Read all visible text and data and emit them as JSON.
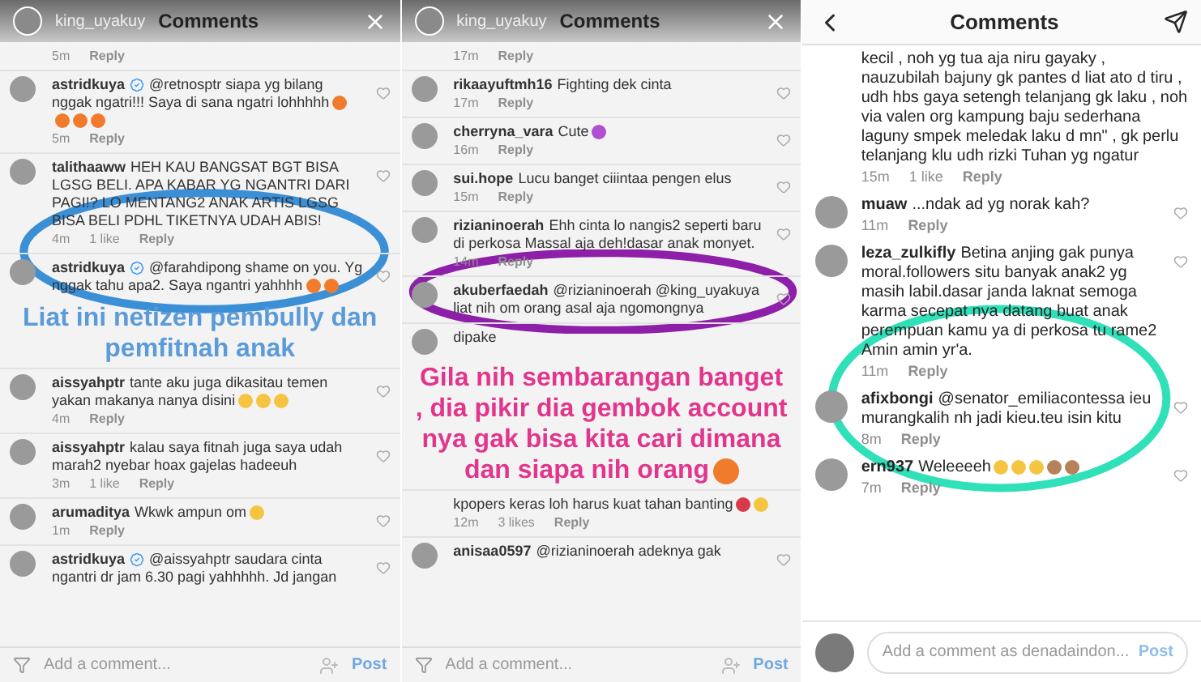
{
  "panels": [
    {
      "header": {
        "kind": "close",
        "username": "king_uyakuy",
        "title": "Comments"
      },
      "comments": [
        {
          "kind": "comment",
          "time": "5m",
          "reply": "Reply"
        },
        {
          "kind": "comment",
          "username": "astridkuya",
          "verified": true,
          "text": "@retnosptr  siapa yg bilang nggak ngatri!!! Saya di sana ngatri lohhhhh",
          "emojis": [
            {
              "kind": "angry"
            },
            {
              "kind": "angry"
            },
            {
              "kind": "angry"
            },
            {
              "kind": "angry"
            }
          ],
          "time": "5m",
          "reply": "Reply"
        },
        {
          "kind": "comment",
          "username": "talithaaww",
          "text": "HEH KAU BANGSAT BGT BISA LGSG BELI. APA KABAR YG NGANTRI DARI PAGI!? LO MENTANG2 ANAK ARTIS LGSG BISA BELI PDHL TIKETNYA UDAH ABIS!",
          "time": "4m",
          "likes": "1 like",
          "reply": "Reply"
        },
        {
          "kind": "comment",
          "username": "astridkuya",
          "verified": true,
          "text": "@farahdipong shame on you. Yg nggak tahu apa2. Saya ngantri yahhhh",
          "emojis": [
            {
              "kind": "angry"
            },
            {
              "kind": "angry"
            }
          ]
        },
        {
          "kind": "caption",
          "text": "Liat ini netizen pembully dan pemfitnah anak",
          "color": "#5b9bd9"
        },
        {
          "kind": "comment",
          "username": "aissyahptr",
          "text": "tante aku juga dikasitau temen yakan makanya nanya disini",
          "emojis": [
            {
              "kind": "laugh"
            },
            {
              "kind": "laugh"
            },
            {
              "kind": "laugh"
            }
          ],
          "time": "4m",
          "reply": "Reply"
        },
        {
          "kind": "comment",
          "username": "aissyahptr",
          "text": "kalau saya fitnah juga saya udah marah2 nyebar hoax gajelas hadeeuh",
          "time": "3m",
          "likes": "1 like",
          "reply": "Reply"
        },
        {
          "kind": "comment",
          "username": "arumaditya",
          "text": "Wkwk ampun om",
          "emojis": [
            {
              "kind": "laugh"
            }
          ],
          "time": "1m",
          "reply": "Reply"
        },
        {
          "kind": "comment",
          "username": "astridkuya",
          "verified": true,
          "text": "@aissyahptr saudara cinta ngantri dr jam 6.30 pagi yahhhhh. Jd jangan"
        }
      ],
      "footer": {
        "kind": "plain",
        "placeholder": "Add a comment...",
        "post": "Post"
      },
      "circle": {
        "color": "#3b8fd6"
      }
    },
    {
      "header": {
        "kind": "close",
        "username": "king_uyakuy",
        "title": "Comments"
      },
      "comments": [
        {
          "kind": "comment",
          "time": "17m",
          "reply": "Reply"
        },
        {
          "kind": "comment",
          "username": "rikaayuftmh16",
          "text": "Fighting dek cinta",
          "time": "17m",
          "reply": "Reply"
        },
        {
          "kind": "comment",
          "username": "cherryna_vara",
          "text": "Cute",
          "emojis": [
            {
              "kind": "purple_heart"
            }
          ],
          "time": "16m",
          "reply": "Reply"
        },
        {
          "kind": "comment",
          "username": "sui.hope",
          "text": "Lucu banget ciiintaa pengen elus",
          "time": "15m",
          "reply": "Reply"
        },
        {
          "kind": "comment",
          "username": "rizianinoerah",
          "text": "Ehh cinta lo nangis2 seperti baru di perkosa Massal aja deh!dasar anak monyet.",
          "time": "14m",
          "reply": "Reply"
        },
        {
          "kind": "comment",
          "username": "akuberfaedah",
          "text": "@rizianinoerah @king_uyakuya liat nih om orang asal aja ngomongnya"
        },
        {
          "kind": "comment",
          "text": "dipake",
          "avatar": true
        },
        {
          "kind": "caption",
          "text": "Gila nih sembarangan banget , dia pikir dia gembok account nya gak bisa kita cari dimana dan siapa nih orang",
          "color": "#e2358c",
          "emojis": [
            {
              "kind": "angry"
            }
          ]
        },
        {
          "kind": "comment",
          "text": "kpopers keras loh harus kuat tahan banting",
          "avatar": false,
          "emojis": [
            {
              "kind": "heart"
            },
            {
              "kind": "laugh"
            }
          ],
          "time": "12m",
          "likes": "3 likes",
          "reply": "Reply"
        },
        {
          "kind": "comment",
          "username": "anisaa0597",
          "text": "@rizianinoerah adeknya gak"
        }
      ],
      "footer": {
        "kind": "plain",
        "placeholder": "Add a comment...",
        "post": "Post"
      },
      "circle": {
        "color": "#8e1fa8"
      }
    },
    {
      "header": {
        "kind": "back",
        "title": "Comments"
      },
      "comments": [
        {
          "kind": "comment",
          "text": "kecil , noh yg tua aja niru gayaky , nauzubilah bajuny gk pantes d liat ato d tiru , udh hbs gaya setengh telanjang gk laku , noh via valen org kampung baju sederhana laguny smpek meledak laku d mn\" , gk perlu telanjang klu udh rizki Tuhan yg ngatur",
          "time": "15m",
          "likes": "1 like",
          "reply": "Reply"
        },
        {
          "kind": "comment",
          "username": "muaw",
          "text": "...ndak ad yg norak kah?",
          "time": "11m",
          "reply": "Reply"
        },
        {
          "kind": "comment",
          "username": "leza_zulkifly",
          "text": "Betina anjing gak punya moral.followers situ banyak anak2 yg masih labil.dasar janda laknat semoga karma secepat nya datang buat anak perempuan kamu ya di perkosa tu rame2 Amin amin yr'a.",
          "time": "11m",
          "reply": "Reply"
        },
        {
          "kind": "comment",
          "username": "afixbongi",
          "text": "@senator_emiliacontessa ieu murangkalih nh jadi kieu.teu isin kitu",
          "time": "8m",
          "reply": "Reply"
        },
        {
          "kind": "comment",
          "username": "ern937",
          "text": "Weleeeeh",
          "emojis": [
            {
              "kind": "tongue"
            },
            {
              "kind": "tongue"
            },
            {
              "kind": "tongue"
            },
            {
              "kind": "monkey"
            },
            {
              "kind": "monkey"
            }
          ],
          "time": "7m",
          "reply": "Reply"
        }
      ],
      "footer": {
        "kind": "rounded",
        "placeholder": "Add a comment as denadaindon...",
        "post": "Post"
      },
      "circle": {
        "color": "#2fe0b8"
      }
    }
  ]
}
